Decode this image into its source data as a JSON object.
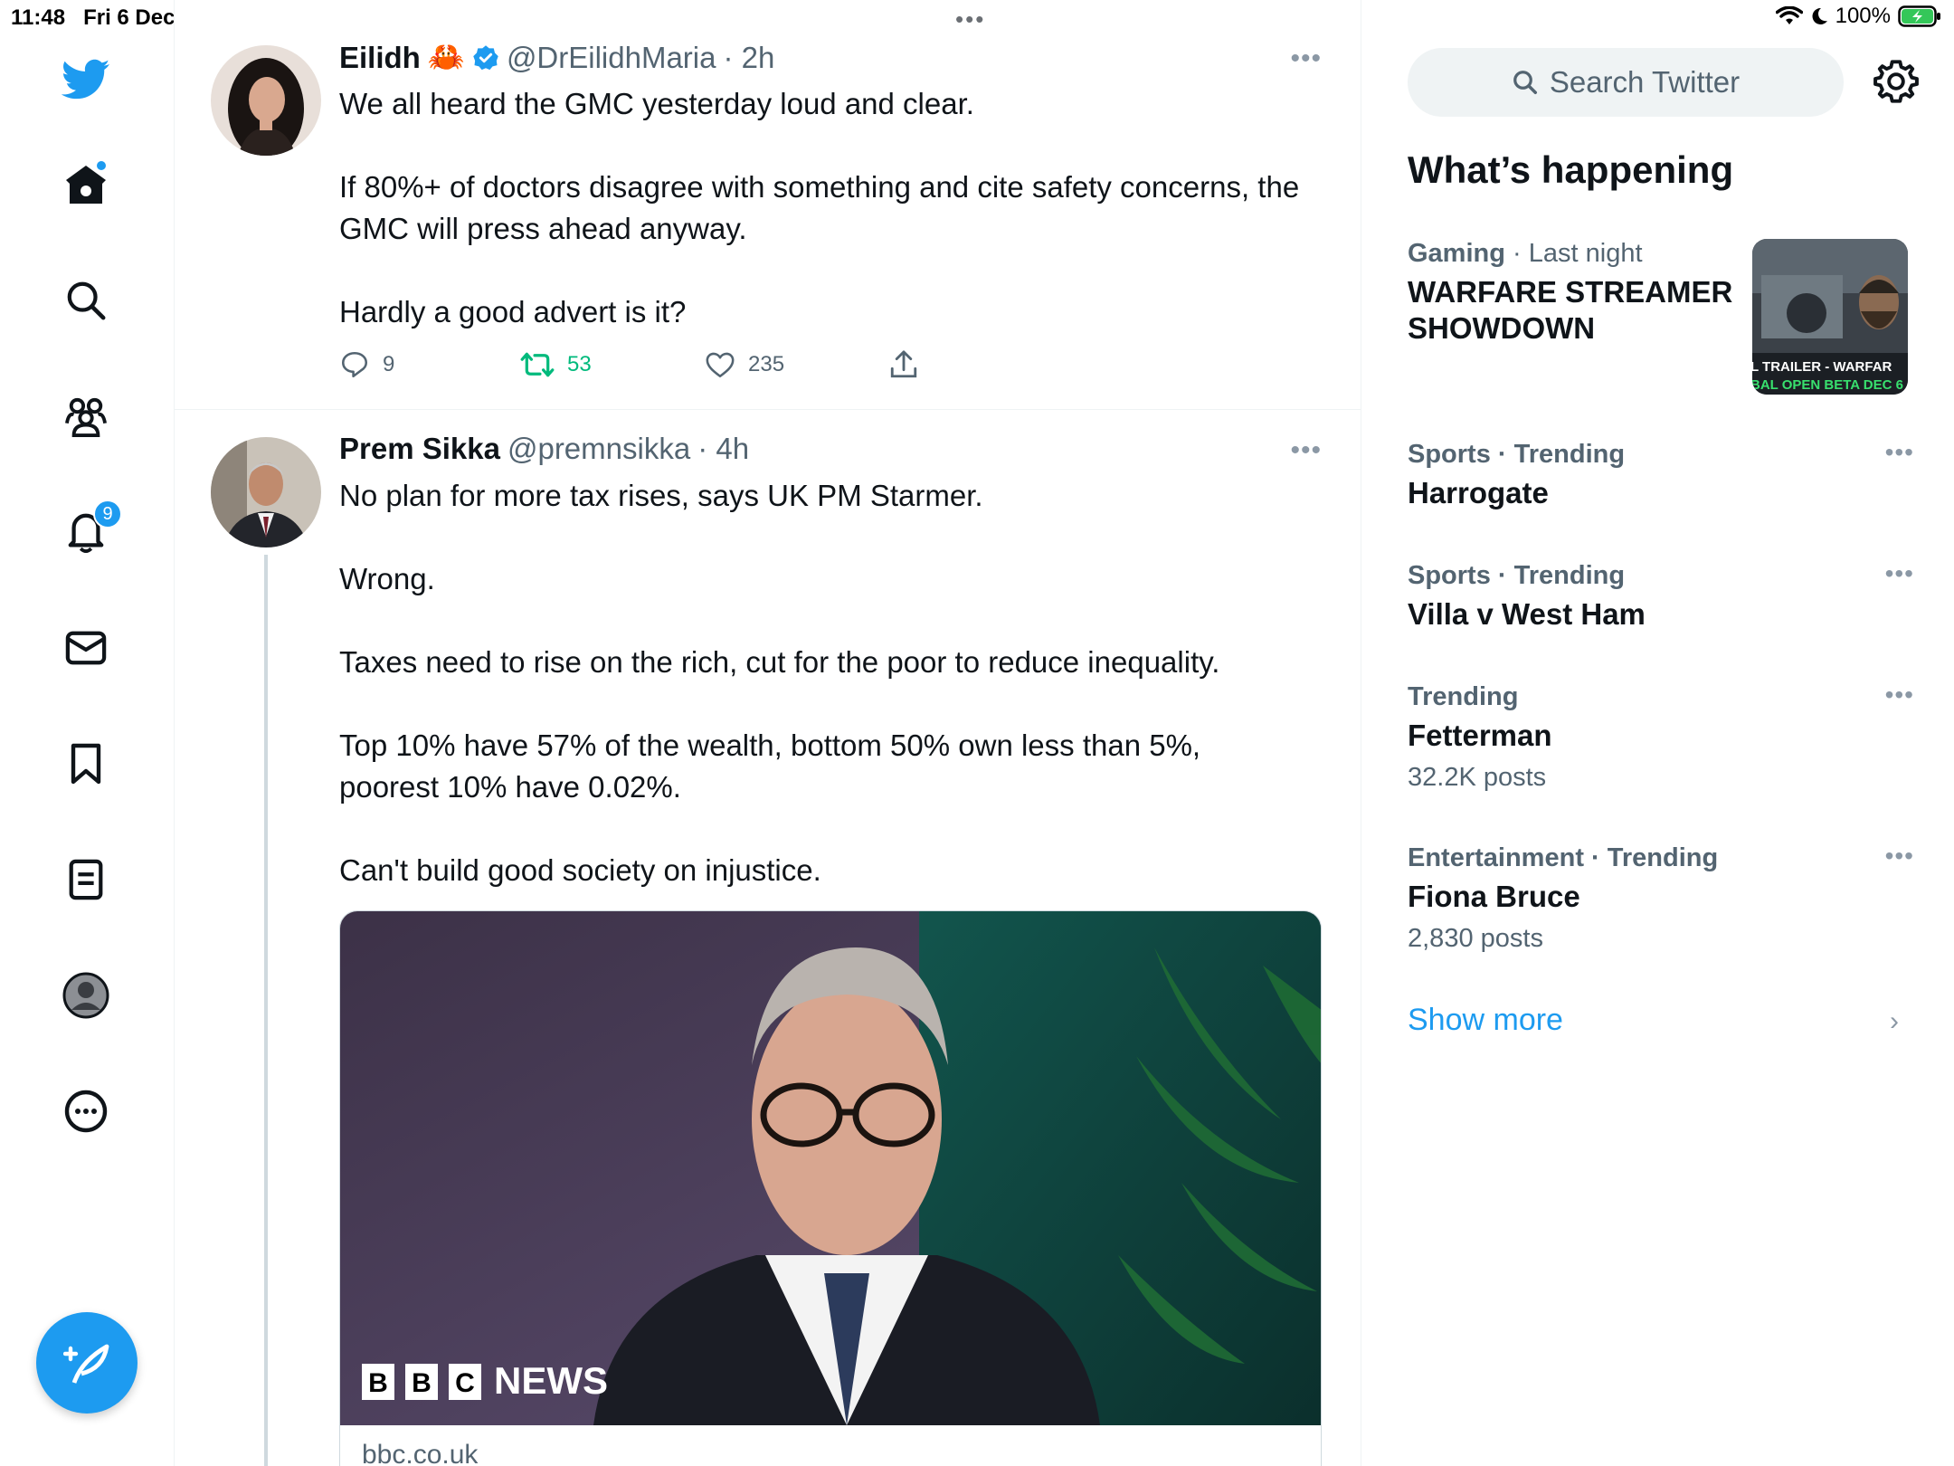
{
  "status": {
    "time": "11:48",
    "date": "Fri 6 Dec",
    "battery": "100%"
  },
  "nav": {
    "notifications_badge": "9",
    "items": [
      "twitter-logo",
      "home-icon",
      "search-icon",
      "communities-icon",
      "bell-icon",
      "mail-icon",
      "bookmark-icon",
      "lists-icon",
      "profile-icon",
      "more-icon"
    ]
  },
  "timeline": {
    "tweets": [
      {
        "name": "Eilidh",
        "emoji": "🦀",
        "handle": "@DrEilidhMaria",
        "time": "· 2h",
        "paragraphs": [
          "We all heard the GMC yesterday loud and clear.",
          "If 80%+ of doctors disagree with something and cite safety concerns, the GMC will press ahead anyway.",
          "Hardly a good advert is it?"
        ],
        "replies": "9",
        "retweets": "53",
        "likes": "235"
      },
      {
        "name": "Prem Sikka",
        "handle": "@premnsikka",
        "time": "· 4h",
        "paragraphs": [
          "No plan for more tax rises, says UK PM Starmer.",
          "Wrong.",
          "Taxes need to rise on the rich, cut for the poor to reduce inequality.",
          "Top 10% have 57% of the wealth, bottom 50% own less than 5%, poorest 10% have 0.02%.",
          "Can't build good society on injustice."
        ],
        "card": {
          "brand": "BBC",
          "brand_suffix": "NEWS",
          "domain": "bbc.co.uk"
        }
      }
    ]
  },
  "sidebar": {
    "search_placeholder": "Search Twitter",
    "whats_happening": "What’s happening",
    "trends": [
      {
        "category": "Gaming",
        "context": "· Last night",
        "name": "WARFARE STREAMER SHOWDOWN",
        "thumb_text_1": "L TRAILER - WARFAR",
        "thumb_text_2": "BAL OPEN BETA DEC 6"
      },
      {
        "category": "Sports · Trending",
        "name": "Harrogate"
      },
      {
        "category": "Sports · Trending",
        "name": "Villa v West Ham"
      },
      {
        "category": "Trending",
        "name": "Fetterman",
        "posts": "32.2K posts"
      },
      {
        "category": "Entertainment · Trending",
        "name": "Fiona Bruce",
        "posts": "2,830 posts"
      }
    ],
    "show_more": "Show more"
  },
  "colors": {
    "accent": "#1d9bf0",
    "retweet": "#00ba7c",
    "text": "#0f1419",
    "secondary": "#536471"
  }
}
